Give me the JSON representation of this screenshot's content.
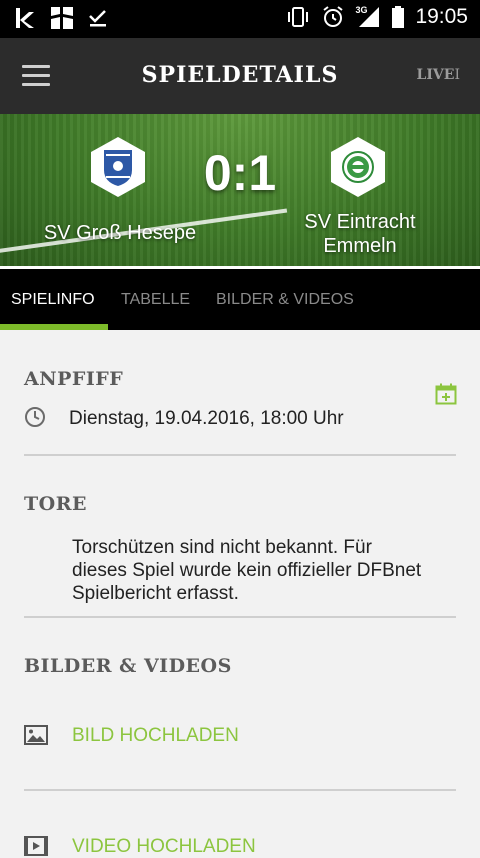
{
  "statusbar": {
    "time": "19:05",
    "network": "3G"
  },
  "appbar": {
    "title": "SPIELDETAILS",
    "live_label": "LIVE"
  },
  "match": {
    "score": "0:1",
    "home_team": "SV Groß Hesepe",
    "away_team_line1": "SV Eintracht",
    "away_team_line2": "Emmeln"
  },
  "tabs": [
    {
      "label": "SPIELINFO"
    },
    {
      "label": "TABELLE"
    },
    {
      "label": "BILDER & VIDEOS"
    }
  ],
  "content": {
    "anpfiff_title": "ANPFIFF",
    "kickoff_text": "Dienstag, 19.04.2016, 18:00 Uhr",
    "tore_title": "TORE",
    "tore_line1": "Torschützen sind nicht bekannt. Für",
    "tore_line2": "dieses Spiel wurde kein offizieller DFBnet",
    "tore_line3": "Spielbericht erfasst.",
    "media_title": "BILDER & VIDEOS",
    "upload_image": "BILD HOCHLADEN",
    "upload_video": "VIDEO HOCHLADEN"
  },
  "colors": {
    "accent_green": "#8cc53f",
    "tab_underline": "#7dbb2a",
    "appbar_bg": "#2c2c2c"
  }
}
